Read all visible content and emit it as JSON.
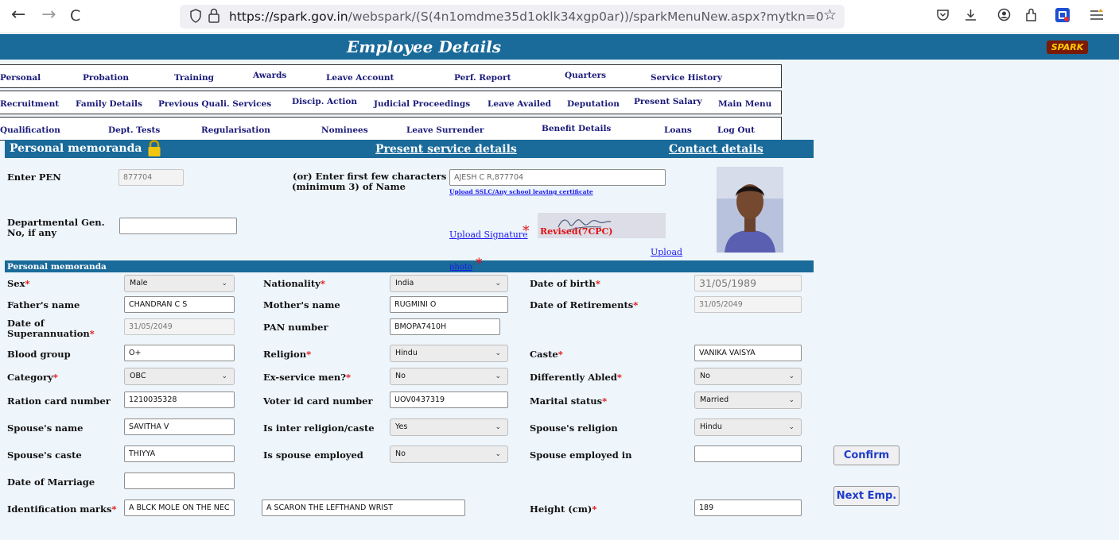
{
  "browser": {
    "back": "←",
    "forward": "→",
    "reload": "C",
    "url_host": "https://spark.gov.in",
    "url_path": "/webspark/(S(4n1omdme35d1oklk34xgp0ar))/sparkMenuNew.aspx?mytkn=0",
    "icons": [
      "shield-icon",
      "lock-icon",
      "star-icon",
      "pocket-icon",
      "download-icon",
      "account-icon",
      "extensions-icon",
      "addon-icon",
      "menu-icon"
    ]
  },
  "header": {
    "title": "Employee Details",
    "logo_text": "SPARK"
  },
  "menu": {
    "row1": [
      "Personal",
      "Probation",
      "Training",
      "Awards",
      "Leave Account",
      "Perf. Report",
      "Quarters",
      "Service History"
    ],
    "row2": [
      "Recruitment",
      "Family Details",
      "Previous Quali. Services",
      "Discip. Action",
      "Judicial Proceedings",
      "Leave Availed",
      "Deputation",
      "Present Salary",
      "Main Menu"
    ],
    "row3": [
      "Qualification",
      "Dept. Tests",
      "Regularisation",
      "Nominees",
      "Leave Surrender",
      "Benefit Details",
      "Loans",
      "Log Out"
    ]
  },
  "section_bar": {
    "title": "Personal memoranda",
    "present_service": "Present service details",
    "contact": "Contact details"
  },
  "pen": {
    "label": "Enter PEN",
    "value": "877704",
    "or_label_1": "(or) Enter first few characters",
    "or_label_2": "(minimum 3) of Name",
    "name_value": "AJESH C R,877704",
    "upload_sslc": "Upload SSLC/Any school leaving certificate"
  },
  "dept": {
    "label_1": "Departmental Gen.",
    "label_2": "No, if any",
    "value": ""
  },
  "signature": {
    "upload_link": "Upload Signature",
    "star": "*",
    "revised": "Revised(7CPC)",
    "upload_photo_1": "Upload",
    "upload_photo_2": "photo"
  },
  "sub_header": "Personal memoranda",
  "form": {
    "sex": {
      "label": "Sex",
      "value": "Male"
    },
    "nationality": {
      "label": "Nationality",
      "value": "India"
    },
    "dob": {
      "label": "Date of birth",
      "value": "31/05/1989"
    },
    "father": {
      "label": "Father's name",
      "value": "CHANDRAN C S"
    },
    "mother": {
      "label": "Mother's name",
      "value": "RUGMINI O"
    },
    "retirement": {
      "label": "Date of Retirements",
      "value": "31/05/2049"
    },
    "superannuation": {
      "label_1": "Date of",
      "label_2": "Superannuation",
      "value": "31/05/2049"
    },
    "pan": {
      "label": "PAN number",
      "value": "BMOPA7410H"
    },
    "blood": {
      "label": "Blood group",
      "value": "O+"
    },
    "religion": {
      "label": "Religion",
      "value": "Hindu"
    },
    "caste": {
      "label": "Caste",
      "value": "VANIKA VAISYA"
    },
    "category": {
      "label": "Category",
      "value": "OBC"
    },
    "exservice": {
      "label": "Ex-service men?",
      "value": "No"
    },
    "disabled": {
      "label": "Differently Abled",
      "value": "No"
    },
    "ration": {
      "label": "Ration card number",
      "value": "1210035328"
    },
    "voter": {
      "label": "Voter id card number",
      "value": "UOV0437319"
    },
    "marital": {
      "label": "Marital status",
      "value": "Married"
    },
    "spouse_name": {
      "label": "Spouse's name",
      "value": "SAVITHA V"
    },
    "inter_religion": {
      "label": "Is inter religion/caste",
      "value": "Yes"
    },
    "spouse_religion": {
      "label": "Spouse's religion",
      "value": "Hindu"
    },
    "spouse_caste": {
      "label": "Spouse's caste",
      "value": "THIYYA"
    },
    "spouse_employed": {
      "label": "Is spouse employed",
      "value": "No"
    },
    "spouse_employed_in": {
      "label": "Spouse employed in",
      "value": ""
    },
    "marriage_date": {
      "label": "Date of Marriage",
      "value": ""
    },
    "id_marks": {
      "label": "Identification marks",
      "value_1": "A BLCK MOLE ON THE NECK",
      "value_2": "A SCARON THE LEFTHAND WRIST"
    },
    "height": {
      "label": "Height (cm)",
      "value": "189"
    },
    "req": "*"
  },
  "buttons": {
    "confirm": "Confirm",
    "next": "Next Emp."
  },
  "colors": {
    "header_blue": "#1a6a9a",
    "link_navy": "#1a1a7a",
    "required_red": "#e01010",
    "button_text": "#1d3cc9"
  }
}
